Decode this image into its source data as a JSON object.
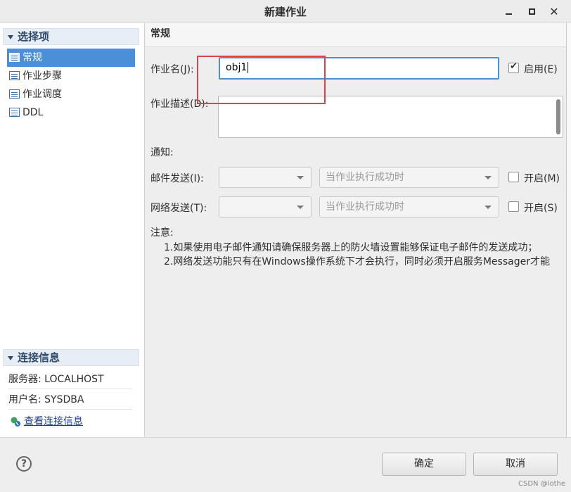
{
  "window": {
    "title": "新建作业"
  },
  "sidebar": {
    "select_header": "选择项",
    "items": [
      {
        "label": "常规",
        "selected": true
      },
      {
        "label": "作业步骤",
        "selected": false
      },
      {
        "label": "作业调度",
        "selected": false
      },
      {
        "label": "DDL",
        "selected": false
      }
    ],
    "conn_header": "连接信息",
    "server_line": "服务器: LOCALHOST",
    "user_line": "用户名: SYSDBA",
    "view_link": "查看连接信息"
  },
  "panel": {
    "title": "常规",
    "job_name_label": "作业名(J):",
    "job_name_value": "obj1",
    "enable_label": "启用(E)",
    "enable_checked": true,
    "desc_label": "作业描述(D):",
    "desc_value": "",
    "notify_label": "通知:",
    "mail_label": "邮件发送(I):",
    "mail_target": "",
    "mail_condition": "当作业执行成功时",
    "mail_enable_label": "开启(M)",
    "net_label": "网络发送(T):",
    "net_target": "",
    "net_condition": "当作业执行成功时",
    "net_enable_label": "开启(S)",
    "note_label": "注意:",
    "note_1": "1.如果使用电子邮件通知请确保服务器上的防火墙设置能够保证电子邮件的发送成功；",
    "note_2": "2.网络发送功能只有在Windows操作系统下才会执行，同时必须开启服务Messager才能"
  },
  "footer": {
    "ok_label": "确定",
    "cancel_label": "取消",
    "help_symbol": "?",
    "watermark": "CSDN @iothe"
  },
  "colors": {
    "selection": "#4a90d9",
    "annotation": "#e0443e"
  }
}
